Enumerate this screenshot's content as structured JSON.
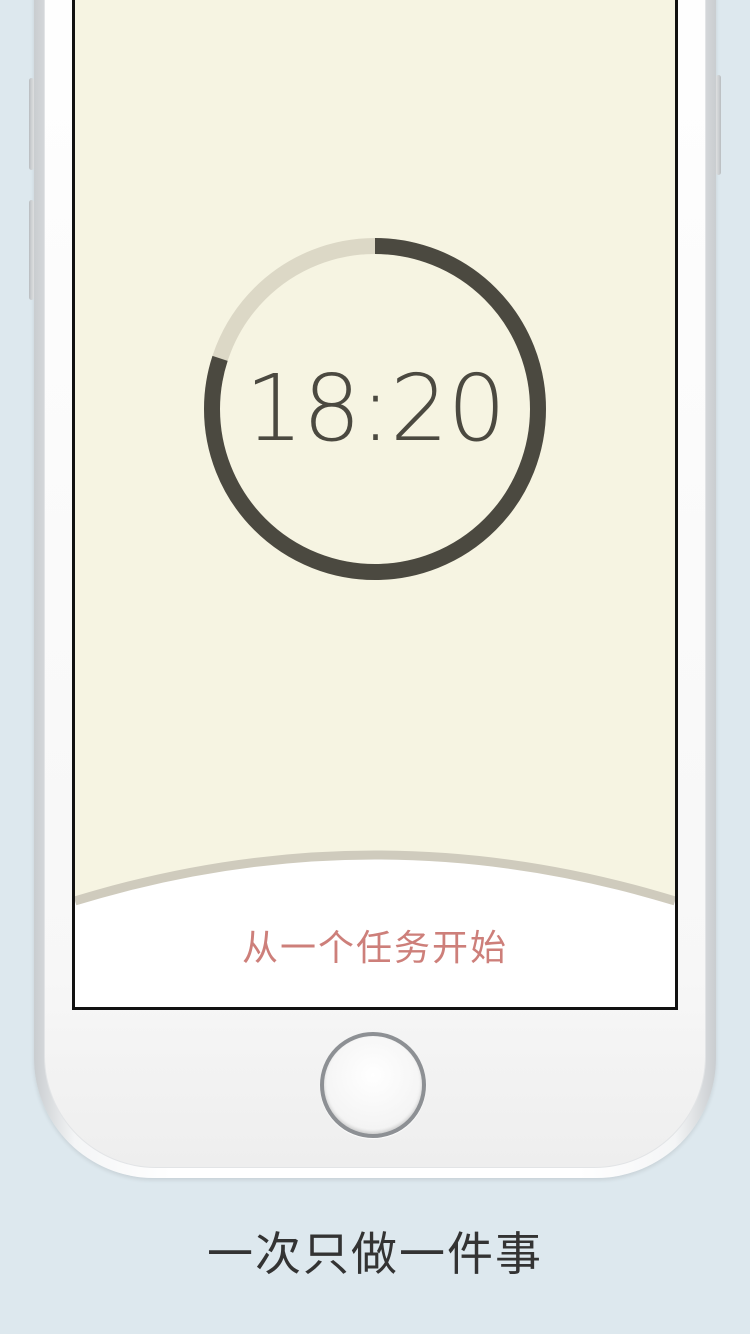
{
  "timer": {
    "time": "18:20",
    "progress_fraction": 0.8,
    "ring_color": "#4b4940",
    "track_color": "#dcd8c6"
  },
  "task_prompt": {
    "label": "从一个任务开始",
    "color": "#cd7f7a"
  },
  "caption": {
    "text": "一次只做一件事"
  },
  "colors": {
    "screen_background": "#f6f4e2",
    "page_background": "#dde8ee",
    "sheet_border": "#cfcbbd"
  }
}
